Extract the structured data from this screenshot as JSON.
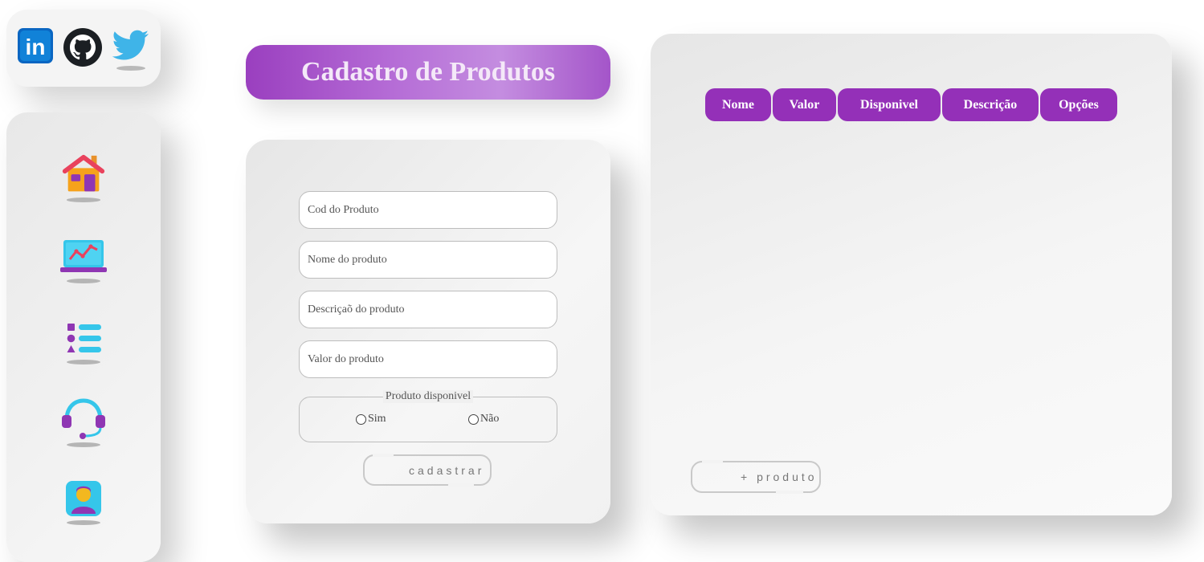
{
  "social": {
    "items": [
      {
        "name": "linkedin",
        "icon": "linkedin-icon",
        "text": "in"
      },
      {
        "name": "github",
        "icon": "github-icon"
      },
      {
        "name": "twitter",
        "icon": "twitter-icon"
      }
    ]
  },
  "nav": {
    "items": [
      {
        "id": "home",
        "icon": "house-icon"
      },
      {
        "id": "dashboard",
        "icon": "laptop-chart-icon"
      },
      {
        "id": "list",
        "icon": "list-icon"
      },
      {
        "id": "support",
        "icon": "headset-icon"
      },
      {
        "id": "profile",
        "icon": "user-profile-icon"
      }
    ]
  },
  "title": "Cadastro de Produtos",
  "form": {
    "cod_placeholder": "Cod do Produto",
    "nome_placeholder": "Nome do produto",
    "descricao_placeholder": "Descriçaõ do produto",
    "valor_placeholder": "Valor do produto",
    "disponivel_legend": "Produto disponivel",
    "sim_label": "Sim",
    "nao_label": "Não",
    "submit_label": "cadastrar"
  },
  "table": {
    "headers": [
      "Nome",
      "Valor",
      "Disponivel",
      "Descrição",
      "Opções"
    ],
    "rows": [],
    "add_label": "+ produto"
  },
  "colors": {
    "accent": "#9430b8",
    "title_gradient_start": "#9a3fbf",
    "title_gradient_mid": "#c48de0",
    "title_text": "#f4e8f8"
  }
}
